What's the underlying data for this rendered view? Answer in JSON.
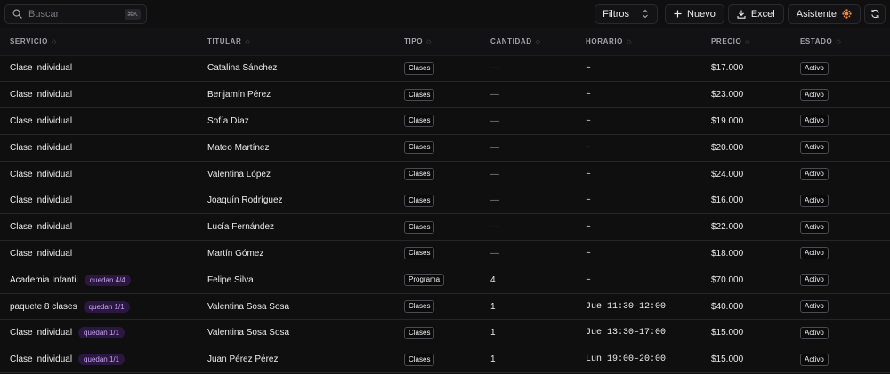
{
  "toolbar": {
    "search_placeholder": "Buscar",
    "shortcut": "⌘K",
    "filters_label": "Filtros",
    "new_label": "Nuevo",
    "excel_label": "Excel",
    "assistant_label": "Asistente",
    "accent_color": "#f08a2c"
  },
  "columns": [
    {
      "label": "SERVICIO"
    },
    {
      "label": "TITULAR"
    },
    {
      "label": "TIPO"
    },
    {
      "label": "CANTIDAD"
    },
    {
      "label": "HORARIO"
    },
    {
      "label": "PRECIO"
    },
    {
      "label": "ESTADO"
    }
  ],
  "rows": [
    {
      "servicio": "Clase individual",
      "badge": "",
      "titular": "Catalina Sánchez",
      "tipo": "Clases",
      "cantidad": "—",
      "horario": "–",
      "precio": "$17.000",
      "estado": "Activo"
    },
    {
      "servicio": "Clase individual",
      "badge": "",
      "titular": "Benjamín Pérez",
      "tipo": "Clases",
      "cantidad": "—",
      "horario": "–",
      "precio": "$23.000",
      "estado": "Activo"
    },
    {
      "servicio": "Clase individual",
      "badge": "",
      "titular": "Sofía Díaz",
      "tipo": "Clases",
      "cantidad": "—",
      "horario": "–",
      "precio": "$19.000",
      "estado": "Activo"
    },
    {
      "servicio": "Clase individual",
      "badge": "",
      "titular": "Mateo Martínez",
      "tipo": "Clases",
      "cantidad": "—",
      "horario": "–",
      "precio": "$20.000",
      "estado": "Activo"
    },
    {
      "servicio": "Clase individual",
      "badge": "",
      "titular": "Valentina López",
      "tipo": "Clases",
      "cantidad": "—",
      "horario": "–",
      "precio": "$24.000",
      "estado": "Activo"
    },
    {
      "servicio": "Clase individual",
      "badge": "",
      "titular": "Joaquín Rodríguez",
      "tipo": "Clases",
      "cantidad": "—",
      "horario": "–",
      "precio": "$16.000",
      "estado": "Activo"
    },
    {
      "servicio": "Clase individual",
      "badge": "",
      "titular": "Lucía Fernández",
      "tipo": "Clases",
      "cantidad": "—",
      "horario": "–",
      "precio": "$22.000",
      "estado": "Activo"
    },
    {
      "servicio": "Clase individual",
      "badge": "",
      "titular": "Martín Gómez",
      "tipo": "Clases",
      "cantidad": "—",
      "horario": "–",
      "precio": "$18.000",
      "estado": "Activo"
    },
    {
      "servicio": "Academia Infantil",
      "badge": "quedan 4/4",
      "titular": "Felipe Silva",
      "tipo": "Programa",
      "cantidad": "4",
      "horario": "–",
      "precio": "$70.000",
      "estado": "Activo"
    },
    {
      "servicio": "paquete 8 clases",
      "badge": "quedan 1/1",
      "titular": "Valentina Sosa Sosa",
      "tipo": "Clases",
      "cantidad": "1",
      "horario": "Jue 11:30–12:00",
      "precio": "$40.000",
      "estado": "Activo"
    },
    {
      "servicio": "Clase individual",
      "badge": "quedan 1/1",
      "titular": "Valentina Sosa Sosa",
      "tipo": "Clases",
      "cantidad": "1",
      "horario": "Jue 13:30–17:00",
      "precio": "$15.000",
      "estado": "Activo"
    },
    {
      "servicio": "Clase individual",
      "badge": "quedan 1/1",
      "titular": "Juan Pérez Pérez",
      "tipo": "Clases",
      "cantidad": "1",
      "horario": "Lun 19:00–20:00",
      "precio": "$15.000",
      "estado": "Activo"
    }
  ]
}
